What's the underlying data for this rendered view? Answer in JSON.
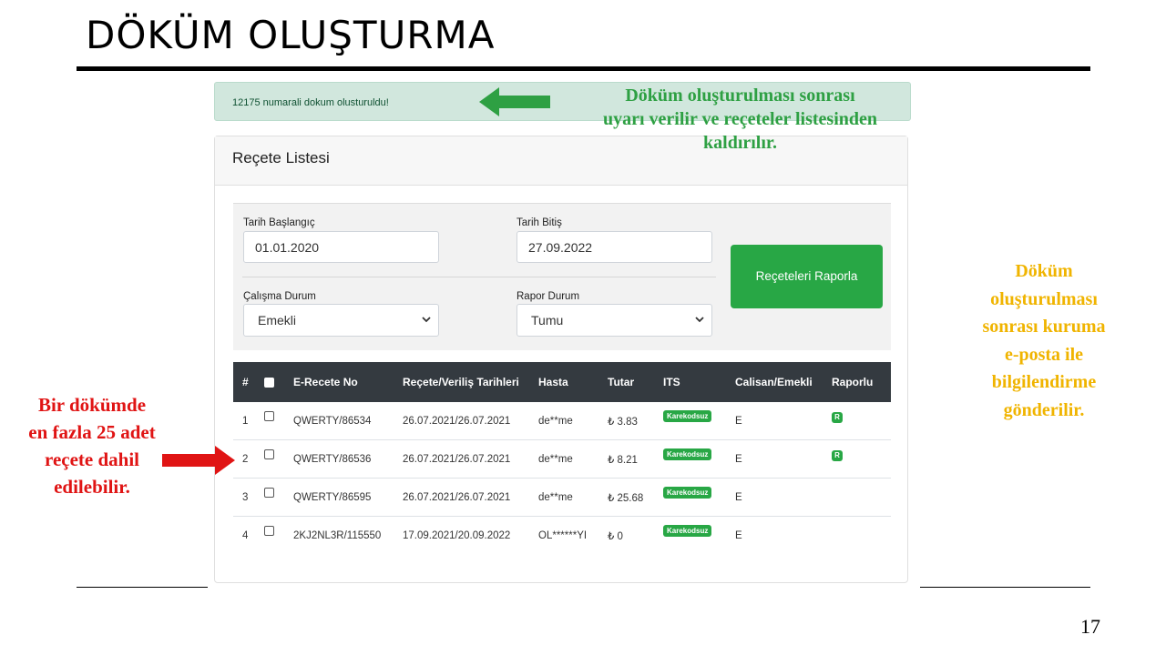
{
  "slide": {
    "title": "DÖKÜM OLUŞTURMA",
    "page_number": "17"
  },
  "alert": {
    "message": "12175 numarali dokum olusturuldu!"
  },
  "card": {
    "title": "Reçete Listesi"
  },
  "filters": {
    "start_date": {
      "label": "Tarih Başlangıç",
      "value": "01.01.2020"
    },
    "end_date": {
      "label": "Tarih Bitiş",
      "value": "27.09.2022"
    },
    "work_status": {
      "label": "Çalışma Durum",
      "value": "Emekli"
    },
    "report_status": {
      "label": "Rapor Durum",
      "value": "Tumu"
    },
    "submit_label": "Reçeteleri Raporla"
  },
  "table": {
    "columns": [
      "#",
      "E-Recete No",
      "Reçete/Veriliş Tarihleri",
      "Hasta",
      "Tutar",
      "ITS",
      "Calisan/Emekli",
      "Raporlu"
    ],
    "rows": [
      {
        "index": "1",
        "rx_no": "QWERTY/86534",
        "dates": "26.07.2021/26.07.2021",
        "patient": "de**me",
        "amount": "₺ 3.83",
        "its": "Karekodsuz",
        "status": "E",
        "report": "R"
      },
      {
        "index": "2",
        "rx_no": "QWERTY/86536",
        "dates": "26.07.2021/26.07.2021",
        "patient": "de**me",
        "amount": "₺ 8.21",
        "its": "Karekodsuz",
        "status": "E",
        "report": "R"
      },
      {
        "index": "3",
        "rx_no": "QWERTY/86595",
        "dates": "26.07.2021/26.07.2021",
        "patient": "de**me",
        "amount": "₺ 25.68",
        "its": "Karekodsuz",
        "status": "E",
        "report": ""
      },
      {
        "index": "4",
        "rx_no": "2KJ2NL3R/115550",
        "dates": "17.09.2021/20.09.2022",
        "patient": "OL******YI",
        "amount": "₺ 0",
        "its": "Karekodsuz",
        "status": "E",
        "report": ""
      }
    ]
  },
  "annotations": {
    "green": [
      "Döküm oluşturulması sonrası",
      "uyarı verilir ve reçeteler listesinden",
      "kaldırılır."
    ],
    "yellow": [
      "Döküm",
      "oluşturulması",
      "sonrası kuruma",
      "e-posta ile",
      "bilgilendirme",
      "gönderilir."
    ],
    "red": [
      "Bir dökümde",
      "en fazla 25 adet",
      "reçete dahil",
      "edilebilir."
    ]
  },
  "colors": {
    "success": "#28a745",
    "table_header": "#343a40",
    "link": "#2a6fdb",
    "annotation_green": "#2ea043",
    "annotation_yellow": "#f0b400",
    "annotation_red": "#e01414"
  }
}
